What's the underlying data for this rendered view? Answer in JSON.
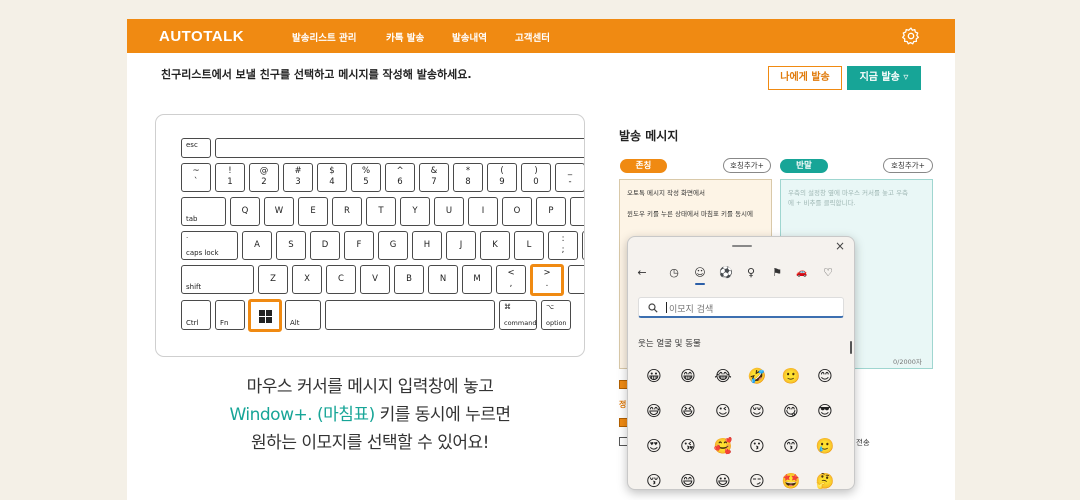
{
  "brand": {
    "logo": "AUTOTALK",
    "accent": "#f08a12",
    "teal": "#17a597"
  },
  "nav": {
    "items": [
      "발송리스트 관리",
      "카톡 발송",
      "발송내역",
      "고객센터"
    ],
    "settings_icon": "gear-icon"
  },
  "header": {
    "instruction": "친구리스트에서 보낼 친구를 선택하고 메시지를 작성해 발송하세요.",
    "send_self": "나에게 발송",
    "send_now": "지금 발송 ▿"
  },
  "keyboard": {
    "esc": "esc",
    "num_top": [
      "~",
      "!",
      "@",
      "#",
      "$",
      "%",
      "^",
      "&",
      "*",
      "(",
      ")",
      "_"
    ],
    "num_bottom": [
      "`",
      "1",
      "2",
      "3",
      "4",
      "5",
      "6",
      "7",
      "8",
      "9",
      "0",
      "-"
    ],
    "row_q": [
      "Q",
      "W",
      "E",
      "R",
      "T",
      "Y",
      "U",
      "I",
      "O",
      "P"
    ],
    "row_a": [
      "A",
      "S",
      "D",
      "F",
      "G",
      "H",
      "J",
      "K",
      "L"
    ],
    "row_z": [
      "Z",
      "X",
      "C",
      "V",
      "B",
      "N",
      "M"
    ],
    "tab": "tab",
    "caps": "caps lock",
    "caps_dot": "·",
    "shift": "shift",
    "ctrl": "Ctrl",
    "fn": "Fn",
    "alt": "Alt",
    "command": "command",
    "command_symbol": "⌘",
    "option": "option",
    "option_symbol": "⌥",
    "comma_top": "<",
    "comma_bottom": ",",
    "period_top": ">",
    "period_bottom": ".",
    "semicolon_top": ":",
    "semicolon_bottom": ";"
  },
  "caption": {
    "line1": "마우스 커서를 메시지 입력창에 놓고",
    "line2_teal": "Window+. (마침표)",
    "line2_rest": " 키를 동시에 누르면",
    "line3": "원하는 이모지를 선택할 수 있어요!"
  },
  "compose": {
    "title": "발송 메시지",
    "formal_badge": "존칭",
    "casual_badge": "반말",
    "add_title": "호칭추가+",
    "formal_text_1": "오토톡 메시지 작성 화면에서",
    "formal_text_2": "윈도우 키를 누른 상태에서 마침표 키를 동시에",
    "casual_placeholder_1": "우측의 설정창 옆에 마우스 커서를 놓고 우측",
    "casual_placeholder_2": "에 + 비추를 클릭합니다.",
    "char_count": "0/2000자",
    "partial_label_1": "정",
    "partial_label_2": "전송"
  },
  "emoji_picker": {
    "search_placeholder": "이모지 검색",
    "section": "웃는 얼굴 및 동물",
    "categories": [
      "←",
      "◷",
      "☺",
      "⚽",
      "♀",
      "⚑",
      "🚗",
      "♡"
    ],
    "grid": [
      [
        "😀",
        "😁",
        "😂",
        "🤣",
        "🙂",
        "😊"
      ],
      [
        "😅",
        "😆",
        "😉",
        "😌",
        "😋",
        "😎"
      ],
      [
        "😍",
        "😘",
        "🥰",
        "😗",
        "😙",
        "🥲"
      ],
      [
        "😚",
        "😄",
        "😃",
        "😏",
        "🤩",
        "🤔"
      ]
    ]
  }
}
